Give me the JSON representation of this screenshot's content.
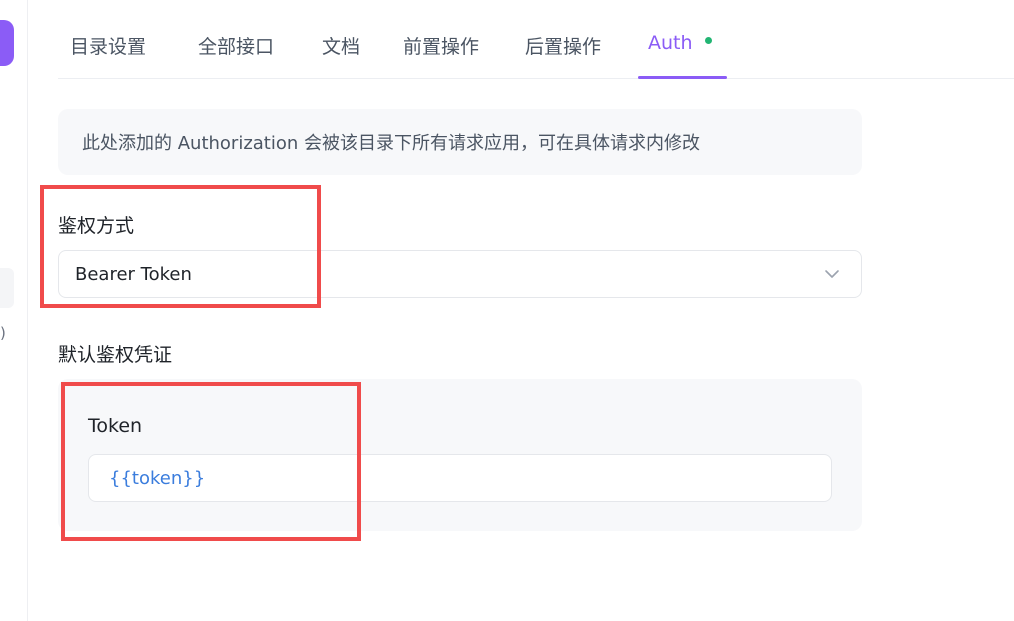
{
  "tabs": [
    {
      "label": "目录设置"
    },
    {
      "label": "全部接口"
    },
    {
      "label": "文档"
    },
    {
      "label": "前置操作"
    },
    {
      "label": "后置操作"
    },
    {
      "label": "Auth",
      "active": true
    }
  ],
  "info_banner": "此处添加的 Authorization 会被该目录下所有请求应用，可在具体请求内修改",
  "auth_method": {
    "label": "鉴权方式",
    "selected_value": "Bearer Token"
  },
  "default_credential": {
    "label": "默认鉴权凭证",
    "token_label": "Token",
    "token_value": "{{token}}"
  },
  "sidebar": {
    "partial_text": ")"
  },
  "colors": {
    "accent": "#8b5cf6",
    "status_dot": "#22b573",
    "annotation": "#f04b4b",
    "variable_text": "#3b7ddd"
  }
}
